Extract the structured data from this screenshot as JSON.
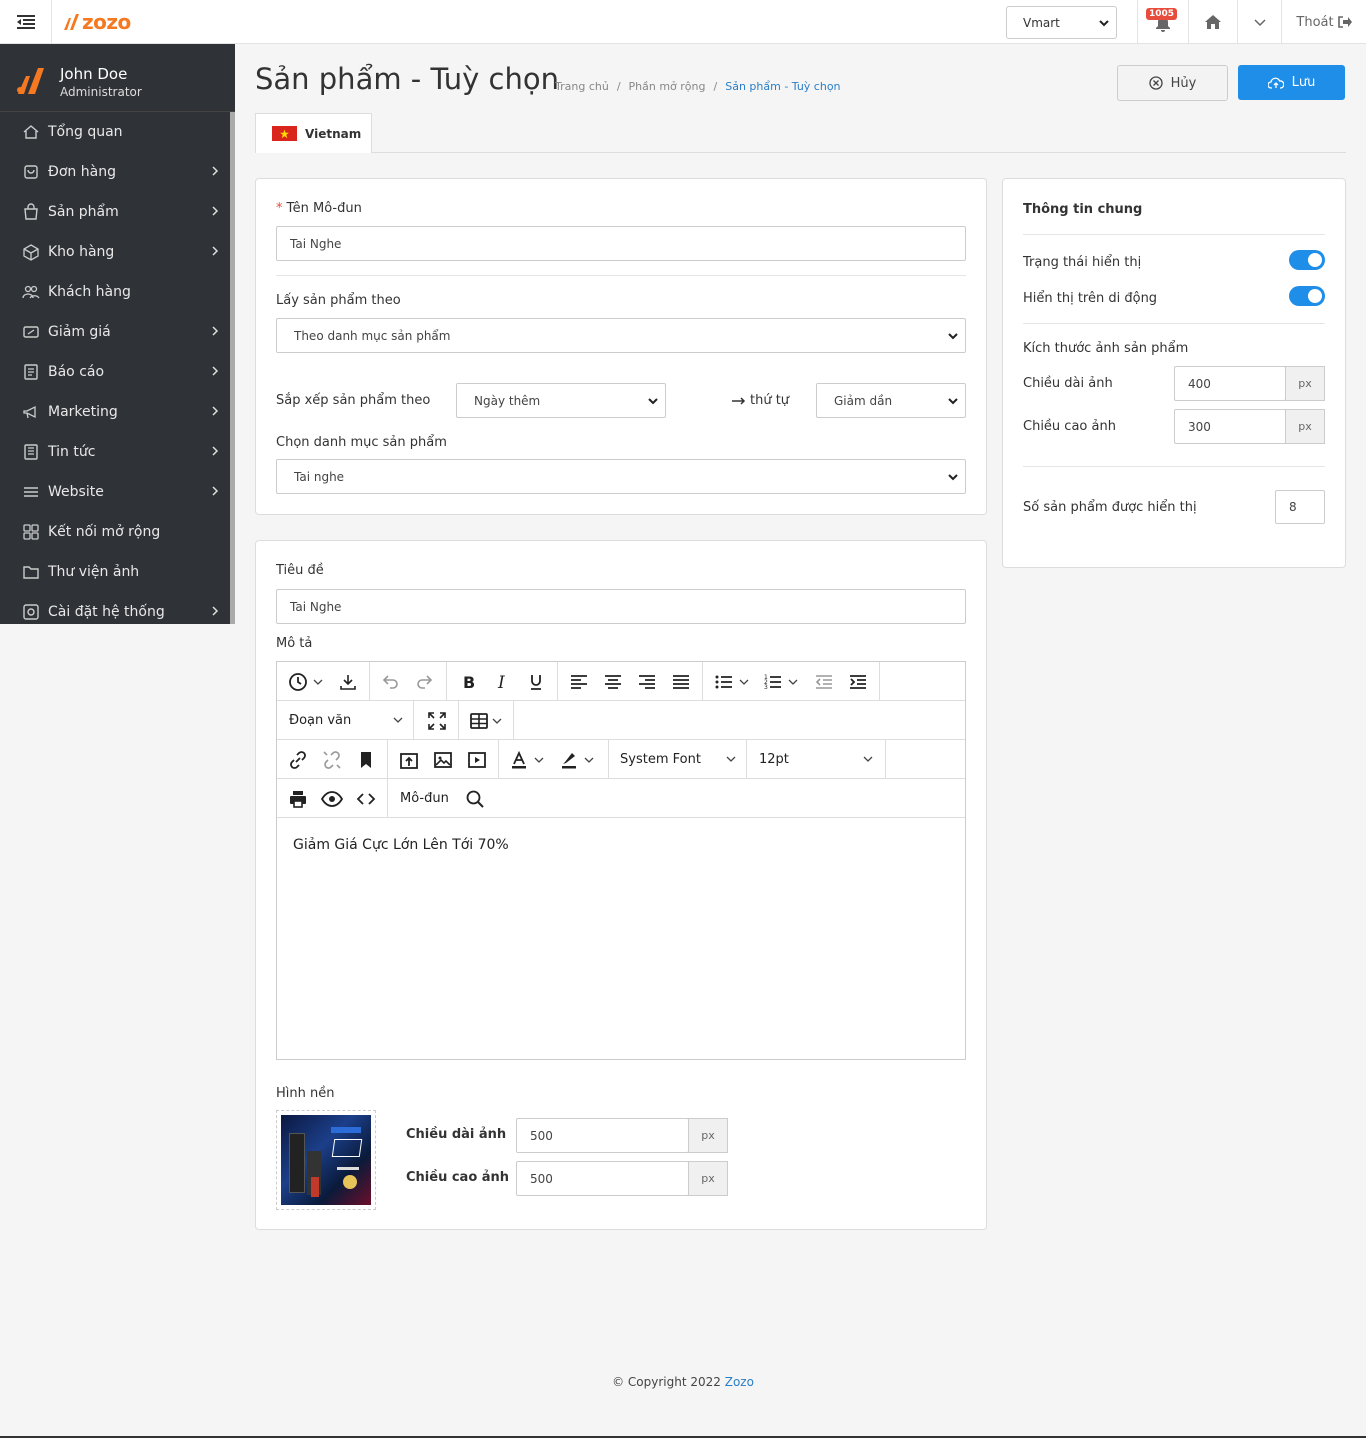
{
  "topbar": {
    "brand": "zozo",
    "store_select": "Vmart",
    "notifications_count": "1005",
    "logout_label": "Thoát"
  },
  "user": {
    "name": "John Doe",
    "role": "Administrator"
  },
  "sidebar": {
    "items": [
      {
        "label": "Tổng quan",
        "icon": "home-icon",
        "has_children": false
      },
      {
        "label": "Đơn hàng",
        "icon": "order-icon",
        "has_children": true
      },
      {
        "label": "Sản phẩm",
        "icon": "bag-icon",
        "has_children": true
      },
      {
        "label": "Kho hàng",
        "icon": "box-icon",
        "has_children": true
      },
      {
        "label": "Khách hàng",
        "icon": "users-icon",
        "has_children": false
      },
      {
        "label": "Giảm giá",
        "icon": "discount-icon",
        "has_children": true
      },
      {
        "label": "Báo cáo",
        "icon": "report-icon",
        "has_children": true
      },
      {
        "label": "Marketing",
        "icon": "marketing-icon",
        "has_children": true
      },
      {
        "label": "Tin tức",
        "icon": "news-icon",
        "has_children": true
      },
      {
        "label": "Website",
        "icon": "website-icon",
        "has_children": true
      },
      {
        "label": "Kết nối mở rộng",
        "icon": "extensions-icon",
        "has_children": false
      },
      {
        "label": "Thư viện ảnh",
        "icon": "folder-icon",
        "has_children": false
      },
      {
        "label": "Cài đặt hệ thống",
        "icon": "settings-icon",
        "has_children": true
      }
    ]
  },
  "header": {
    "title": "Sản phẩm - Tuỳ chọn",
    "breadcrumb": [
      "Trang chủ",
      "Phần mở rộng",
      "Sản phẩm - Tuỳ chọn"
    ],
    "cancel_label": "Hủy",
    "save_label": "Lưu"
  },
  "tab": {
    "label": "Vietnam"
  },
  "module_form": {
    "name_label": "Tên Mô-đun",
    "name_value": "Tai Nghe",
    "source_label": "Lấy sản phẩm theo",
    "source_value": "Theo danh mục sản phẩm",
    "sort_label": "Sắp xếp sản phẩm theo",
    "sort_value": "Ngày thêm",
    "order_label": "thứ tự",
    "order_value": "Giảm dần",
    "category_label": "Chọn danh mục sản phẩm",
    "category_value": "Tai nghe"
  },
  "content_form": {
    "title_label": "Tiêu đề",
    "title_value": "Tai Nghe",
    "desc_label": "Mô tả",
    "editor": {
      "block_format": "Đoạn văn",
      "font_family": "System Font",
      "font_size": "12pt",
      "module_button": "Mô-đun",
      "body_text": "Giảm Giá Cực Lớn Lên Tới 70%"
    },
    "bg_label": "Hình nền",
    "bg_width_label": "Chiều dài ảnh",
    "bg_width_value": "500",
    "bg_height_label": "Chiều cao ảnh",
    "bg_height_value": "500",
    "unit": "px"
  },
  "general": {
    "title": "Thông tin chung",
    "status_label": "Trạng thái hiển thị",
    "status_on": true,
    "mobile_label": "Hiển thị trên di động",
    "mobile_on": true,
    "img_size_label": "Kích thước ảnh sản phẩm",
    "img_width_label": "Chiều dài ảnh",
    "img_width_value": "400",
    "img_height_label": "Chiều cao ảnh",
    "img_height_value": "300",
    "unit": "px",
    "count_label": "Số sản phẩm được hiển thị",
    "count_value": "8"
  },
  "footer": {
    "text": "© Copyright 2022",
    "brand": "Zozo"
  },
  "colors": {
    "accent": "#1e8ee8",
    "brand": "#f47920",
    "sidebar": "#2f3237",
    "badge": "#e74c3c"
  }
}
